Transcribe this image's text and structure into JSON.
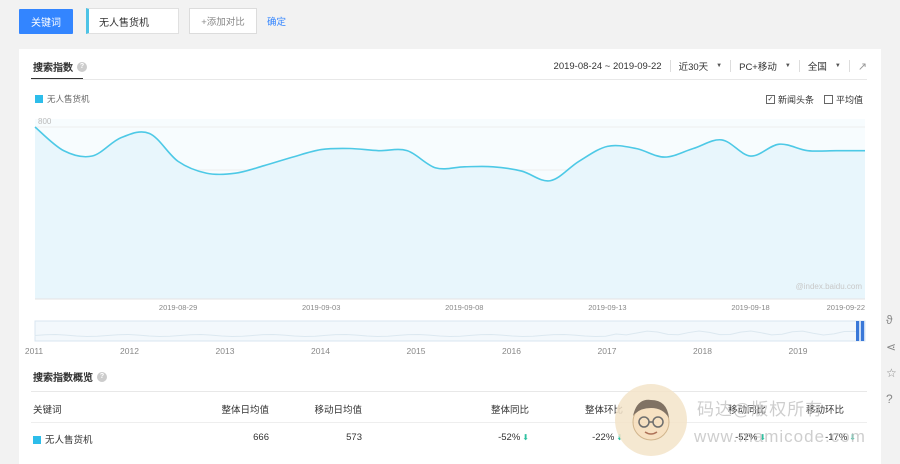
{
  "top_bar": {
    "keyword_button": "关键词",
    "keyword_value": "无人售货机",
    "add_compare": "+添加对比",
    "confirm": "确定"
  },
  "search_index": {
    "title": "搜索指数",
    "help": "?",
    "date_range": "2019-08-24 ~ 2019-09-22",
    "period": "近30天",
    "device": "PC+移动",
    "region": "全国",
    "export_icon": "↗",
    "legend": "无人售货机",
    "news_checkbox": "新闻头条",
    "news_checked_mark": "✓",
    "avg_checkbox": "平均值",
    "chart_watermark": "@index.baidu.com"
  },
  "chart_data": {
    "type": "area",
    "series": [
      {
        "name": "无人售货机",
        "color": "#4dc9e6",
        "x": [
          "2019-08-24",
          "2019-08-25",
          "2019-08-26",
          "2019-08-27",
          "2019-08-28",
          "2019-08-29",
          "2019-08-30",
          "2019-08-31",
          "2019-09-01",
          "2019-09-02",
          "2019-09-03",
          "2019-09-04",
          "2019-09-05",
          "2019-09-06",
          "2019-09-07",
          "2019-09-08",
          "2019-09-09",
          "2019-09-10",
          "2019-09-11",
          "2019-09-12",
          "2019-09-13",
          "2019-09-14",
          "2019-09-15",
          "2019-09-16",
          "2019-09-17",
          "2019-09-18",
          "2019-09-19",
          "2019-09-20",
          "2019-09-21",
          "2019-09-22"
        ],
        "values": [
          800,
          690,
          665,
          750,
          770,
          640,
          585,
          585,
          620,
          660,
          695,
          700,
          690,
          690,
          610,
          615,
          615,
          595,
          550,
          640,
          710,
          700,
          660,
          700,
          740,
          665,
          720,
          690,
          690,
          690
        ]
      }
    ],
    "xticks": [
      "2019-08-29",
      "2019-09-03",
      "2019-09-08",
      "2019-09-13",
      "2019-09-18",
      "2019-09-22"
    ],
    "yticks": [
      "800",
      "600",
      "400",
      "200"
    ],
    "ylim": [
      0,
      800
    ],
    "grid": true
  },
  "overview_slider": {
    "years": [
      "2011",
      "2012",
      "2013",
      "2014",
      "2015",
      "2016",
      "2017",
      "2018",
      "2019"
    ]
  },
  "summary": {
    "title": "搜索指数概览",
    "help": "?",
    "headers": {
      "keyword": "关键词",
      "overall_avg": "整体日均值",
      "mobile_avg": "移动日均值",
      "overall_yoy": "整体同比",
      "overall_mom": "整体环比",
      "mobile_yoy": "移动同比",
      "mobile_mom": "移动环比"
    },
    "row": {
      "keyword": "无人售货机",
      "overall_avg": "666",
      "mobile_avg": "573",
      "overall_yoy": "-52%",
      "overall_mom": "-22%",
      "mobile_yoy": "-52%",
      "mobile_mom": "-17%",
      "down_arrow": "⬇"
    }
  },
  "watermark": {
    "line1": "码达@版权所有",
    "line2": "www.mamicode.com"
  },
  "rail_icons": {
    "top": "ϑ",
    "share": "⋖",
    "star": "☆",
    "help": "?"
  },
  "colors": {
    "accent": "#3385ff",
    "series": "#4dc9e6",
    "down": "#2fc1a1"
  }
}
